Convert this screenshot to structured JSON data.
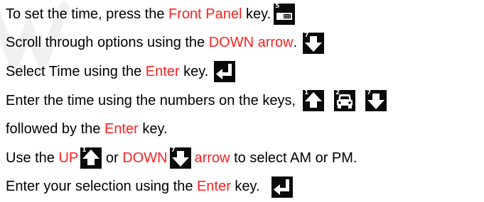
{
  "colors": {
    "highlight": "#ff2020",
    "text": "#000000",
    "key_bg": "#0a0a0a",
    "key_fg": "#ffffff"
  },
  "lines": [
    {
      "pre": "To set the time, press the ",
      "hl": "Front Panel",
      "post": " key.",
      "key_num": "5",
      "key_icon": "front-panel-icon"
    },
    {
      "pre": "Scroll through options using the ",
      "hl": "DOWN arrow",
      "post": ".",
      "key_num": "7",
      "key_icon": "down-arrow-icon"
    },
    {
      "pre": "Select Time using the ",
      "hl": "Enter",
      "post": " key.",
      "key_icon": "enter-icon"
    },
    {
      "text": "Enter the time using the numbers on the keys,",
      "keys": [
        {
          "num": "1",
          "icon": "up-arrow-icon"
        },
        {
          "num": "2",
          "icon": "car-icon"
        },
        {
          "num": "7",
          "icon": "down-arrow-icon"
        }
      ]
    },
    {
      "pre": "followed by the ",
      "hl": "Enter",
      "post": " key."
    },
    {
      "pre": "Use the ",
      "hl1": "UP",
      "key1_num": "1",
      "mid": " or ",
      "hl2": "DOWN",
      "key2_num": "7",
      "hl3": "arrow",
      "post": " to select AM or PM."
    },
    {
      "pre": "Enter your selection using the ",
      "hl": "Enter",
      "post": " key.",
      "key_icon": "enter-icon"
    }
  ]
}
